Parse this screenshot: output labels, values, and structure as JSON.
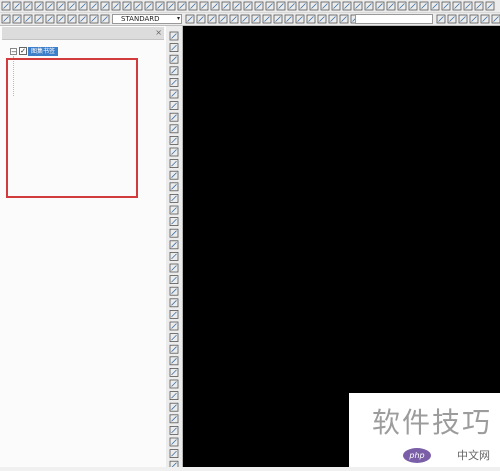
{
  "toolbar": {
    "text_style": "STANDARD"
  },
  "palette": {
    "tree_root_label": "图集书签"
  },
  "watermark": {
    "main_text": "软件技巧",
    "sub_text": "中文网",
    "logo_text": "php"
  },
  "colors": {
    "canvas_bg": "#000000",
    "highlight_box": "#d23b3b",
    "tree_selected": "#3d7ec8"
  }
}
